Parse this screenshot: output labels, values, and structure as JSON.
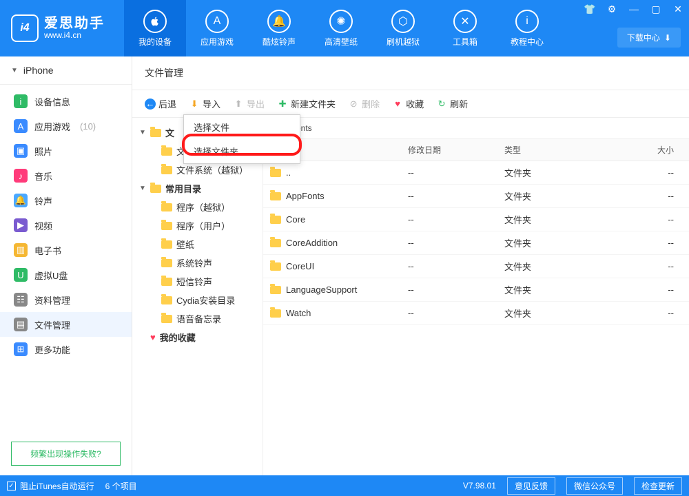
{
  "app": {
    "name": "爱思助手",
    "url": "www.i4.cn",
    "logo_text": "i4"
  },
  "download_center": "下载中心",
  "nav": [
    {
      "label": "我的设备",
      "glyph": ""
    },
    {
      "label": "应用游戏",
      "glyph": "A"
    },
    {
      "label": "酷炫铃声",
      "glyph": "🔔"
    },
    {
      "label": "高清壁纸",
      "glyph": "✺"
    },
    {
      "label": "刷机越狱",
      "glyph": "⬡"
    },
    {
      "label": "工具箱",
      "glyph": "✕"
    },
    {
      "label": "教程中心",
      "glyph": "i"
    }
  ],
  "device": "iPhone",
  "sidebar": [
    {
      "label": "设备信息",
      "color": "#2fbb66",
      "glyph": "i"
    },
    {
      "label": "应用游戏",
      "suffix": "(10)",
      "color": "#3a8bff",
      "glyph": "A"
    },
    {
      "label": "照片",
      "color": "#3a8bff",
      "glyph": "▣"
    },
    {
      "label": "音乐",
      "color": "#ff3b7a",
      "glyph": "♪"
    },
    {
      "label": "铃声",
      "color": "#4aa8ff",
      "glyph": "🔔"
    },
    {
      "label": "视频",
      "color": "#7a5bd0",
      "glyph": "▶"
    },
    {
      "label": "电子书",
      "color": "#f5b733",
      "glyph": "▥"
    },
    {
      "label": "虚拟U盘",
      "color": "#2fbb66",
      "glyph": "U"
    },
    {
      "label": "资料管理",
      "color": "#888",
      "glyph": "☷"
    },
    {
      "label": "文件管理",
      "color": "#888",
      "glyph": "▤",
      "active": true
    },
    {
      "label": "更多功能",
      "color": "#3a8bff",
      "glyph": "⊞"
    }
  ],
  "troubleshoot": "频繁出现操作失败?",
  "main_title": "文件管理",
  "toolbar": {
    "back": "后退",
    "import": "导入",
    "export": "导出",
    "newfolder": "新建文件夹",
    "delete": "删除",
    "favorite": "收藏",
    "refresh": "刷新"
  },
  "popup": {
    "item1": "选择文件",
    "item2": "选择文件夹"
  },
  "tree": {
    "root": "文",
    "root2": "文",
    "sys": "文件系统（越狱）",
    "common": "常用目录",
    "items": [
      "程序（越狱）",
      "程序（用户）",
      "壁纸",
      "系统铃声",
      "短信铃声",
      "Cydia安装目录",
      "语音备忘录"
    ],
    "fav": "我的收藏"
  },
  "path": "brary/Fonts",
  "columns": {
    "name": "称",
    "date": "修改日期",
    "type": "类型",
    "size": "大小"
  },
  "rows": [
    {
      "name": "..",
      "date": "--",
      "type": "文件夹",
      "size": "--"
    },
    {
      "name": "AppFonts",
      "date": "--",
      "type": "文件夹",
      "size": "--"
    },
    {
      "name": "Core",
      "date": "--",
      "type": "文件夹",
      "size": "--"
    },
    {
      "name": "CoreAddition",
      "date": "--",
      "type": "文件夹",
      "size": "--"
    },
    {
      "name": "CoreUI",
      "date": "--",
      "type": "文件夹",
      "size": "--"
    },
    {
      "name": "LanguageSupport",
      "date": "--",
      "type": "文件夹",
      "size": "--"
    },
    {
      "name": "Watch",
      "date": "--",
      "type": "文件夹",
      "size": "--"
    }
  ],
  "status": {
    "itunes": "阻止iTunes自动运行",
    "count": "6 个项目",
    "version": "V7.98.01",
    "feedback": "意见反馈",
    "wechat": "微信公众号",
    "update": "检查更新"
  }
}
